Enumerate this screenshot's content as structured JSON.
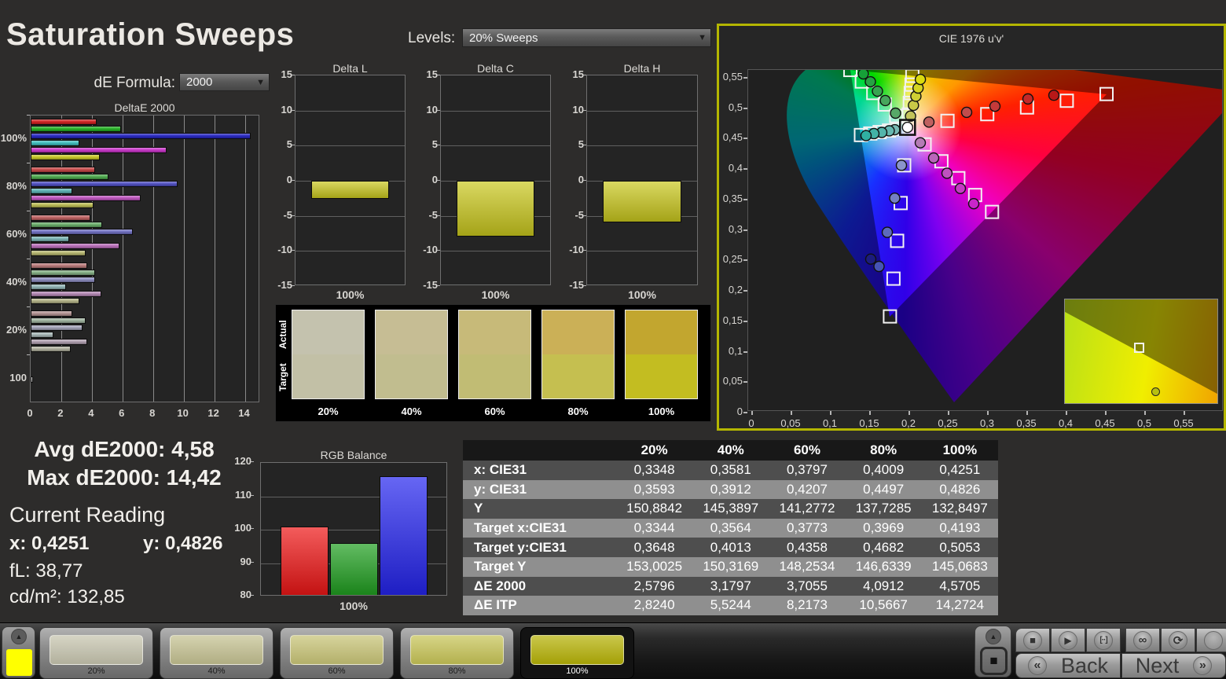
{
  "header": {
    "title": "Saturation Sweeps",
    "de_formula_label": "dE Formula:",
    "de_formula_value": "2000",
    "levels_label": "Levels:",
    "levels_value": "20% Sweeps",
    "dropdown_arrow": "▼"
  },
  "stats": {
    "avg": "Avg dE2000: 4,58",
    "max": "Max dE2000: 14,42",
    "current_reading_label": "Current Reading",
    "x_value": "x: 0,4251",
    "y_value": "y: 0,4826",
    "fl_value": "fL: 38,77",
    "cdm2_value": "cd/m²: 132,85"
  },
  "swatch_strip": {
    "actual_label": "Actual",
    "target_label": "Target",
    "items": [
      {
        "label": "20%",
        "actual": "#c4c2ae",
        "target": "#c2c0a6"
      },
      {
        "label": "40%",
        "actual": "#c6bd94",
        "target": "#c1bd8f"
      },
      {
        "label": "60%",
        "actual": "#c7ba79",
        "target": "#c1bc74"
      },
      {
        "label": "80%",
        "actual": "#cbb057",
        "target": "#c5bf50"
      },
      {
        "label": "100%",
        "actual": "#c2a62f",
        "target": "#c3bd21"
      }
    ]
  },
  "table": {
    "columns": [
      "20%",
      "40%",
      "60%",
      "80%",
      "100%"
    ],
    "rows": [
      {
        "label": "x: CIE31",
        "values": [
          "0,3348",
          "0,3581",
          "0,3797",
          "0,4009",
          "0,4251"
        ]
      },
      {
        "label": "y: CIE31",
        "values": [
          "0,3593",
          "0,3912",
          "0,4207",
          "0,4497",
          "0,4826"
        ]
      },
      {
        "label": "Y",
        "values": [
          "150,8842",
          "145,3897",
          "141,2772",
          "137,7285",
          "132,8497"
        ]
      },
      {
        "label": "Target x:CIE31",
        "values": [
          "0,3344",
          "0,3564",
          "0,3773",
          "0,3969",
          "0,4193"
        ]
      },
      {
        "label": "Target y:CIE31",
        "values": [
          "0,3648",
          "0,4013",
          "0,4358",
          "0,4682",
          "0,5053"
        ]
      },
      {
        "label": "Target Y",
        "values": [
          "153,0025",
          "150,3169",
          "148,2534",
          "146,6339",
          "145,0683"
        ]
      },
      {
        "label": "ΔE 2000",
        "values": [
          "2,5796",
          "3,1797",
          "3,7055",
          "4,0912",
          "4,5705"
        ]
      },
      {
        "label": "ΔE ITP",
        "values": [
          "2,8240",
          "5,5244",
          "8,2173",
          "10,5667",
          "14,2724"
        ]
      }
    ]
  },
  "bottom_bar": {
    "palette_color": "#ffff00",
    "up_icon": "▲",
    "stop_icon": "■",
    "swatches": [
      {
        "label": "20%",
        "color": "#c6c4ae",
        "active": false
      },
      {
        "label": "40%",
        "color": "#c4c191",
        "active": false
      },
      {
        "label": "60%",
        "color": "#c7c376",
        "active": false
      },
      {
        "label": "80%",
        "color": "#c7c457",
        "active": false
      },
      {
        "label": "100%",
        "color": "#b6b207",
        "active": true
      }
    ],
    "media_buttons": [
      {
        "name": "stop-icon",
        "glyph": "■"
      },
      {
        "name": "play-icon",
        "glyph": "▶"
      },
      {
        "name": "single-measure-icon",
        "glyph": "[··]"
      },
      {
        "name": "continuous-icon",
        "glyph": "∞"
      },
      {
        "name": "refresh-icon",
        "glyph": "⟳"
      },
      {
        "name": "blank-icon",
        "glyph": ""
      }
    ],
    "back_icon": "«",
    "back_label": "Back",
    "next_label": "Next",
    "next_icon": "»"
  },
  "chart_data": [
    {
      "id": "deltae2000",
      "type": "bar",
      "orientation": "horizontal",
      "title": "DeltaE 2000",
      "xlim": [
        0,
        15
      ],
      "xticks": [
        0,
        2,
        4,
        6,
        8,
        10,
        12,
        14
      ],
      "groups": [
        {
          "label": "100%",
          "values": [
            4.3,
            5.9,
            14.4,
            3.2,
            8.9,
            4.5
          ],
          "colors": [
            "#d01d1d",
            "#1fae1f",
            "#2323c0",
            "#3bbcbc",
            "#c832c8",
            "#c6c623"
          ]
        },
        {
          "label": "80%",
          "values": [
            4.2,
            5.1,
            9.6,
            2.7,
            7.2,
            4.1
          ],
          "colors": [
            "#c44343",
            "#4aa84a",
            "#4c4cc0",
            "#58b1b1",
            "#bd52bd",
            "#b9b950"
          ]
        },
        {
          "label": "60%",
          "values": [
            3.9,
            4.7,
            6.7,
            2.5,
            5.8,
            3.6
          ],
          "colors": [
            "#bd5d5d",
            "#64a964",
            "#6c6cbf",
            "#76b1b1",
            "#b76bb7",
            "#b4b46c"
          ]
        },
        {
          "label": "40%",
          "values": [
            3.7,
            4.2,
            4.2,
            2.3,
            4.6,
            3.2
          ],
          "colors": [
            "#b87878",
            "#80ab80",
            "#8989bc",
            "#90b3b3",
            "#b184b1",
            "#b0b084"
          ]
        },
        {
          "label": "20%",
          "values": [
            2.7,
            3.6,
            3.4,
            1.5,
            3.7,
            2.6
          ],
          "colors": [
            "#b19090",
            "#9cb19c",
            "#a0a0b6",
            "#a4b4b4",
            "#ad9cad",
            "#aeae9c"
          ]
        },
        {
          "label": "100",
          "values": [
            0.15
          ],
          "colors": [
            "#e8e8e8"
          ]
        }
      ]
    },
    {
      "id": "delta_l",
      "type": "bar",
      "title": "Delta L",
      "category": "100%",
      "value": -2.6,
      "ylim": [
        -15,
        15
      ],
      "yticks": [
        15,
        10,
        5,
        0,
        -5,
        -10,
        -15
      ],
      "color": "#c9c71d"
    },
    {
      "id": "delta_c",
      "type": "bar",
      "title": "Delta C",
      "category": "100%",
      "value": -8.0,
      "ylim": [
        -15,
        15
      ],
      "yticks": [
        15,
        10,
        5,
        0,
        -5,
        -10,
        -15
      ],
      "color": "#c9c71d"
    },
    {
      "id": "delta_h",
      "type": "bar",
      "title": "Delta H",
      "category": "100%",
      "value": -5.9,
      "ylim": [
        -15,
        15
      ],
      "yticks": [
        15,
        10,
        5,
        0,
        -5,
        -10,
        -15
      ],
      "color": "#c9c71d"
    },
    {
      "id": "rgb_balance",
      "type": "bar",
      "title": "RGB Balance",
      "category": "100%",
      "ylim": [
        80,
        120
      ],
      "yticks": [
        120,
        110,
        100,
        90,
        80
      ],
      "series": [
        {
          "name": "Red",
          "value": 101,
          "color": "#ee1515"
        },
        {
          "name": "Green",
          "value": 96,
          "color": "#1f9f1f"
        },
        {
          "name": "Blue",
          "value": 116,
          "color": "#2424ee"
        }
      ]
    },
    {
      "id": "cie",
      "type": "scatter",
      "title": "CIE 1976 u'v'",
      "xlim": [
        0,
        0.6
      ],
      "ylim": [
        0,
        0.5625
      ],
      "xticks": [
        "0",
        "0,05",
        "0,1",
        "0,15",
        "0,2",
        "0,25",
        "0,3",
        "0,35",
        "0,4",
        "0,45",
        "0,5",
        "0,55"
      ],
      "yticks": [
        "0",
        "0,05",
        "0,1",
        "0,15",
        "0,2",
        "0,25",
        "0,3",
        "0,35",
        "0,4",
        "0,45",
        "0,5",
        "0,55"
      ],
      "white_point": {
        "u": 0.1978,
        "v": 0.4683,
        "color": "#ffffff"
      },
      "series": [
        {
          "name": "red",
          "targets": [
            [
              0.2486,
              0.479
            ],
            [
              0.2992,
              0.49
            ],
            [
              0.3498,
              0.501
            ],
            [
              0.4004,
              0.512
            ],
            [
              0.451,
              0.523
            ]
          ],
          "measured": [
            [
              0.225,
              0.477
            ],
            [
              0.273,
              0.493
            ],
            [
              0.309,
              0.503
            ],
            [
              0.351,
              0.515
            ],
            [
              0.384,
              0.521
            ]
          ],
          "dot_colors": [
            "#c06060",
            "#c24c4c",
            "#c43a3a",
            "#c62828",
            "#b81818"
          ]
        },
        {
          "name": "green",
          "targets": [
            [
              0.1834,
              0.4869
            ],
            [
              0.1688,
              0.5058
            ],
            [
              0.1542,
              0.5247
            ],
            [
              0.1396,
              0.5436
            ],
            [
              0.125,
              0.5625
            ]
          ],
          "measured": [
            [
              0.1825,
              0.4916
            ],
            [
              0.1695,
              0.5123
            ],
            [
              0.1595,
              0.5277
            ],
            [
              0.1505,
              0.5432
            ],
            [
              0.1415,
              0.5561
            ]
          ],
          "dot_colors": [
            "#57a868",
            "#47a65c",
            "#37a450",
            "#27a244",
            "#16a038"
          ]
        },
        {
          "name": "blue",
          "targets": [
            [
              0.1935,
              0.406
            ],
            [
              0.189,
              0.344
            ],
            [
              0.1845,
              0.282
            ],
            [
              0.1799,
              0.2199
            ],
            [
              0.1754,
              0.1579
            ]
          ],
          "measured": [
            [
              0.19,
              0.406
            ],
            [
              0.1815,
              0.352
            ],
            [
              0.172,
              0.296
            ],
            [
              0.1615,
              0.24
            ],
            [
              0.151,
              0.252
            ]
          ],
          "dot_colors": [
            "#8b94cc",
            "#747fc4",
            "#5d6abc",
            "#4654b4",
            "#1c1c7e"
          ]
        },
        {
          "name": "cyan",
          "targets": [
            [
              0.1861,
              0.4655
            ],
            [
              0.1742,
              0.4631
            ],
            [
              0.1623,
              0.4606
            ],
            [
              0.1504,
              0.4582
            ],
            [
              0.1385,
              0.4557
            ]
          ],
          "measured": [
            [
              0.1815,
              0.4645
            ],
            [
              0.1745,
              0.4626
            ],
            [
              0.165,
              0.46
            ],
            [
              0.155,
              0.4581
            ],
            [
              0.145,
              0.4548
            ]
          ],
          "dot_colors": [
            "#78bab4",
            "#66b8b0",
            "#54b5ab",
            "#42b2a6",
            "#30b0a2"
          ]
        },
        {
          "name": "magenta",
          "targets": [
            [
              0.2195,
              0.4403
            ],
            [
              0.2409,
              0.4126
            ],
            [
              0.2624,
              0.3849
            ],
            [
              0.2838,
              0.3572
            ],
            [
              0.3053,
              0.3295
            ]
          ],
          "measured": [
            [
              0.214,
              0.443
            ],
            [
              0.231,
              0.418
            ],
            [
              0.248,
              0.393
            ],
            [
              0.265,
              0.368
            ],
            [
              0.282,
              0.343
            ]
          ],
          "dot_colors": [
            "#b57bb5",
            "#ba66ba",
            "#bf51bf",
            "#c43cc4",
            "#c926c9"
          ]
        },
        {
          "name": "yellow",
          "targets": [
            [
              0.1994,
              0.4894
            ],
            [
              0.2007,
              0.5085
            ],
            [
              0.2019,
              0.5247
            ],
            [
              0.2029,
              0.5385
            ],
            [
              0.2039,
              0.5529
            ]
          ],
          "measured": [
            [
              0.2016,
              0.4868
            ],
            [
              0.2053,
              0.5045
            ],
            [
              0.2084,
              0.5194
            ],
            [
              0.2112,
              0.5329
            ],
            [
              0.2141,
              0.547
            ]
          ],
          "dot_colors": [
            "#c3c35a",
            "#c9c947",
            "#cfcf34",
            "#d5d521",
            "#dbdb0e"
          ]
        }
      ],
      "inset": {
        "target": [
          0.487,
          0.46
        ],
        "measured": [
          0.59,
          0.88
        ]
      }
    }
  ]
}
